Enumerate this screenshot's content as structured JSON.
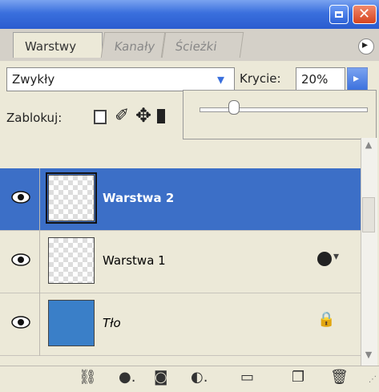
{
  "tabs": [
    {
      "label": "Warstwy",
      "active": true
    },
    {
      "label": "Kanały",
      "active": false
    },
    {
      "label": "Ścieżki",
      "active": false
    }
  ],
  "options": {
    "blend_mode": "Zwykły",
    "opacity_label": "Krycie:",
    "opacity_value": "20%",
    "opacity_level": 0.2,
    "lock_label": "Zablokuj:"
  },
  "layers": [
    {
      "name": "Warstwa 2",
      "selected": true,
      "visible": true
    },
    {
      "name": "Warstwa 1",
      "selected": false,
      "visible": true
    },
    {
      "name": "Tło",
      "selected": false,
      "visible": true
    }
  ],
  "icons": {
    "visibility": "eye-icon",
    "effects": "fx-icon",
    "background_lock": "lock-icon",
    "link": "link-icon",
    "add_style": "layer-style-icon",
    "mask": "mask-icon",
    "adjustment": "adjustment-icon",
    "group": "folder-icon",
    "new_layer": "new-layer-icon",
    "delete": "trash-icon"
  },
  "colors": {
    "selection": "#3c6fc7",
    "titlebar": "#3a6fdd"
  }
}
